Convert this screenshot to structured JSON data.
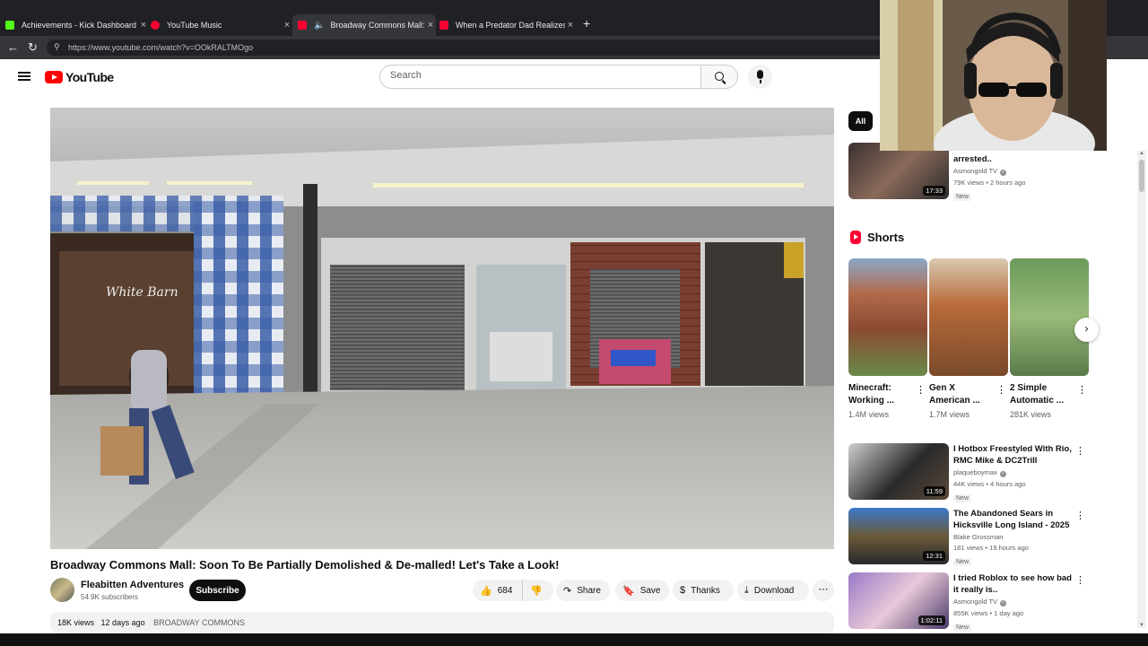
{
  "browser": {
    "tabs": [
      {
        "title": "Achievements - Kick Dashboard",
        "favicon_color": "#53fc18",
        "active": false
      },
      {
        "title": "YouTube Music",
        "favicon_color": "#ff0033",
        "active": false
      },
      {
        "title": "Broadway Commons Mall: S",
        "favicon_color": "#ff0033",
        "active": true
      },
      {
        "title": "When a Predator Dad Realizes He",
        "favicon_color": "#ff0033",
        "active": false
      }
    ],
    "close_glyph": "×",
    "new_tab_glyph": "+",
    "back_glyph": "←",
    "reload_glyph": "↻",
    "url": "https://www.youtube.com/watch?v=OOkRALTMOgo"
  },
  "header": {
    "logo_text": "YouTube",
    "search_placeholder": "Search"
  },
  "video": {
    "title": "Broadway Commons Mall: Soon To Be Partially Demolished & De-malled! Let's Take a Look!",
    "channel_name": "Fleabitten Adventures",
    "subscribers": "54.9K subscribers",
    "subscribe_label": "Subscribe",
    "likes": "684",
    "share_label": "Share",
    "save_label": "Save",
    "thanks_label": "Thanks",
    "download_label": "Download",
    "more_glyph": "⋯",
    "views": "18K views",
    "age": "12 days ago",
    "hashtag": "BROADWAY COMMONS"
  },
  "sidebar": {
    "chip_all": "All",
    "recommendations_top": [
      {
        "title": "arrested..",
        "channel": "Asmongold TV",
        "verified": true,
        "meta": "79K views • 2 hours ago",
        "badge": "New",
        "duration": "17:33"
      }
    ],
    "shorts_title": "Shorts",
    "shorts": [
      {
        "title": "Minecraft: Working ...",
        "views": "1.4M views"
      },
      {
        "title": "Gen X American ...",
        "views": "1.7M views"
      },
      {
        "title": "2 Simple Automatic ...",
        "views": "281K views"
      }
    ],
    "recommendations": [
      {
        "title": "I Hotbox Freestyled With Rio, RMC Mike & DC2Trill",
        "channel": "plaqueboymax",
        "verified": true,
        "meta": "44K views • 4 hours ago",
        "badge": "New",
        "duration": "11:59"
      },
      {
        "title": "The Abandoned Sears in Hicksville Long Island - 2025 ...",
        "channel": "Blake Grossman",
        "verified": false,
        "meta": "181 views • 19 hours ago",
        "badge": "New",
        "duration": "12:31"
      },
      {
        "title": "I tried Roblox to see how bad it really is..",
        "channel": "Asmongold TV",
        "verified": true,
        "meta": "855K views • 1 day ago",
        "badge": "New",
        "duration": "1:02:11"
      }
    ],
    "kebab_glyph": "⋮",
    "next_glyph": "›"
  },
  "colors": {
    "youtube_red": "#ff0000",
    "chrome_dark": "#202124",
    "chip_dark": "#0f0f0f"
  }
}
